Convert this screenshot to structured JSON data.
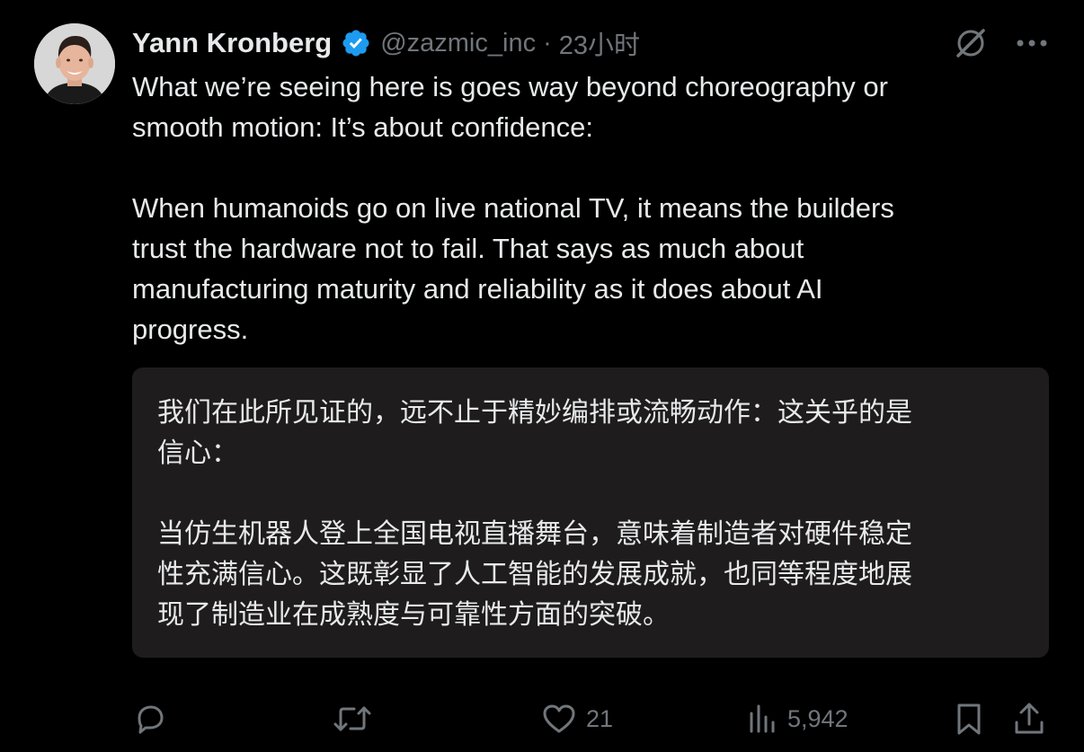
{
  "author": {
    "display_name": "Yann Kronberg",
    "handle": "@zazmic_inc",
    "separator": "·",
    "time": "23小时",
    "verified": true
  },
  "icons": {
    "grok": "grok-icon",
    "more": "more-options-icon",
    "verified": "verified-badge-icon",
    "reply": "reply-icon",
    "retweet": "retweet-icon",
    "like": "like-icon",
    "views": "views-icon",
    "bookmark": "bookmark-icon",
    "share": "share-icon"
  },
  "tweet": {
    "text": "What we’re seeing here is goes way beyond choreography or\nsmooth motion: It’s about confidence:\n\nWhen humanoids go on live national TV, it means the builders\ntrust the hardware not to fail. That says as much about\nmanufacturing maturity and reliability as it does about AI\nprogress."
  },
  "translation": {
    "text": "我们在此所见证的，远不止于精妙编排或流畅动作：这关乎的是\n信心：\n\n当仿生机器人登上全国电视直播舞台，意味着制造者对硬件稳定\n性充满信心。这既彰显了人工智能的发展成就，也同等程度地展\n现了制造业在成熟度与可靠性方面的突破。"
  },
  "actions": {
    "reply_count": "",
    "retweet_count": "",
    "like_count": "21",
    "views_count": "5,942"
  },
  "colors": {
    "background": "#000000",
    "text": "#e7e9ea",
    "secondary": "#71767b",
    "verified_blue": "#1d9bf0",
    "translation_bg": "#1e1c1c"
  }
}
